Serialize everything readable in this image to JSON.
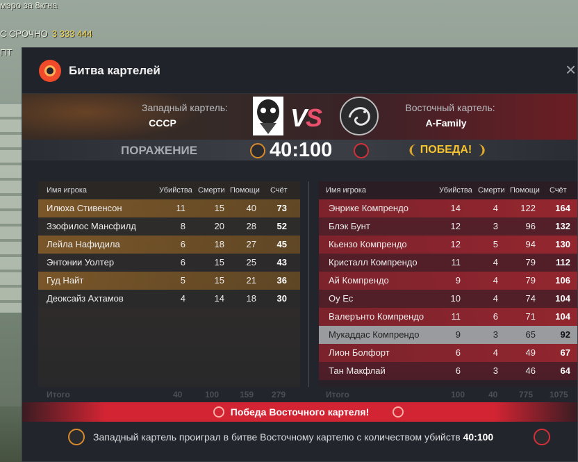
{
  "background": {
    "line1": "мэро за 8кгна",
    "line2_prefix": "С СРОЧНО",
    "line2_value": "3 333 444",
    "line3": "ПТ"
  },
  "window": {
    "title": "Битва картелей",
    "close": "×"
  },
  "banner": {
    "left_label": "Западный картель:",
    "left_name": "СССР",
    "right_label": "Восточный картель:",
    "right_name": "A-Family",
    "vs_v": "V",
    "vs_s": "S"
  },
  "result": {
    "left_status": "ПОРАЖЕНИЕ",
    "score": "40:100",
    "right_status": "ПОБЕДА!"
  },
  "table_headers": {
    "player": "Имя игрока",
    "kills": "Убийства",
    "deaths": "Смерти",
    "assists": "Помощи",
    "score": "Счёт"
  },
  "left_rows": [
    {
      "name": "Илюха Стивенсон",
      "kills": "11",
      "deaths": "15",
      "assists": "40",
      "score": "73"
    },
    {
      "name": "Ззофилос Мансфилд",
      "kills": "8",
      "deaths": "20",
      "assists": "28",
      "score": "52"
    },
    {
      "name": "Лейла Нафидила",
      "kills": "6",
      "deaths": "18",
      "assists": "27",
      "score": "45"
    },
    {
      "name": "Энтонии Уолтер",
      "kills": "6",
      "deaths": "15",
      "assists": "25",
      "score": "43"
    },
    {
      "name": "Гуд Найт",
      "kills": "5",
      "deaths": "15",
      "assists": "21",
      "score": "36"
    },
    {
      "name": "Деоксайз Ахтамов",
      "kills": "4",
      "deaths": "14",
      "assists": "18",
      "score": "30"
    }
  ],
  "right_rows": [
    {
      "name": "Энрике Компрендо",
      "kills": "14",
      "deaths": "4",
      "assists": "122",
      "score": "164"
    },
    {
      "name": "Блэк Бунт",
      "kills": "12",
      "deaths": "3",
      "assists": "96",
      "score": "132"
    },
    {
      "name": "Кьензо Компрендо",
      "kills": "12",
      "deaths": "5",
      "assists": "94",
      "score": "130"
    },
    {
      "name": "Кристалл Компрендо",
      "kills": "11",
      "deaths": "4",
      "assists": "79",
      "score": "112"
    },
    {
      "name": "Ай Компрендо",
      "kills": "9",
      "deaths": "4",
      "assists": "79",
      "score": "106"
    },
    {
      "name": "Оу Ес",
      "kills": "10",
      "deaths": "4",
      "assists": "74",
      "score": "104"
    },
    {
      "name": "Валерънто Компрендо",
      "kills": "11",
      "deaths": "6",
      "assists": "71",
      "score": "104"
    },
    {
      "name": "Мукаддас Компрендо",
      "kills": "9",
      "deaths": "3",
      "assists": "65",
      "score": "92"
    },
    {
      "name": "Лион Болфорт",
      "kills": "6",
      "deaths": "4",
      "assists": "49",
      "score": "67"
    },
    {
      "name": "Тан Макфлай",
      "kills": "6",
      "deaths": "3",
      "assists": "46",
      "score": "64"
    }
  ],
  "totals": {
    "label": "Итого",
    "left": {
      "kills": "40",
      "deaths": "100",
      "assists": "159",
      "score": "279"
    },
    "right": {
      "kills": "100",
      "deaths": "40",
      "assists": "775",
      "score": "1075"
    }
  },
  "footer": {
    "banner": "Победа Восточного картеля!",
    "summary": "Западный картель проиграл в битве Восточному картелю с количеством убийств",
    "summary_score": "40:100"
  },
  "colors": {
    "west_accent": "#d98a2b",
    "east_accent": "#d5303a",
    "victory_gold": "#f5c230",
    "window_bg": "#22252b"
  }
}
